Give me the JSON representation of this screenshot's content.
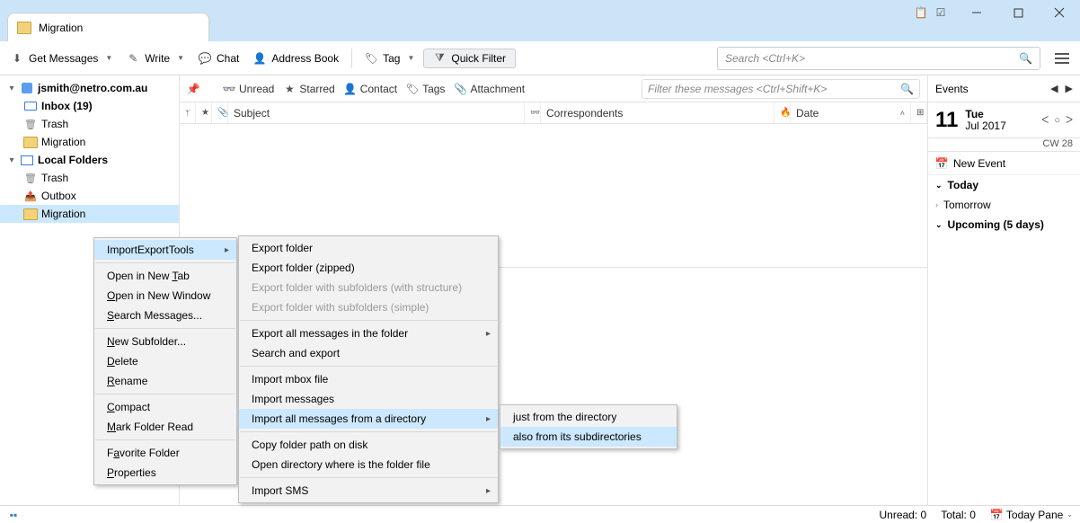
{
  "window": {
    "tab_title": "Migration"
  },
  "toolbar": {
    "get_messages": "Get Messages",
    "write": "Write",
    "chat": "Chat",
    "address_book": "Address Book",
    "tag": "Tag",
    "quick_filter": "Quick Filter",
    "search_placeholder": "Search <Ctrl+K>"
  },
  "tree": {
    "account": "jsmith@netro.com.au",
    "inbox": "Inbox (19)",
    "trash": "Trash",
    "migration": "Migration",
    "local_folders": "Local Folders",
    "lf_trash": "Trash",
    "lf_outbox": "Outbox",
    "lf_migration": "Migration"
  },
  "filterbar": {
    "unread": "Unread",
    "starred": "Starred",
    "contact": "Contact",
    "tags": "Tags",
    "attachment": "Attachment",
    "filter_placeholder": "Filter these messages <Ctrl+Shift+K>"
  },
  "columns": {
    "subject": "Subject",
    "correspondents": "Correspondents",
    "date": "Date"
  },
  "ctx1": {
    "import_export_tools": "ImportExportTools",
    "open_new_tab": "Open in New Tab",
    "open_new_window": "Open in New Window",
    "search_messages": "Search Messages...",
    "new_subfolder": "New Subfolder...",
    "delete": "Delete",
    "rename": "Rename",
    "compact": "Compact",
    "mark_folder_read": "Mark Folder Read",
    "favorite_folder": "Favorite Folder",
    "properties": "Properties"
  },
  "ctx2": {
    "export_folder": "Export folder",
    "export_folder_zipped": "Export folder (zipped)",
    "export_subfolders_structure": "Export folder with subfolders (with structure)",
    "export_subfolders_simple": "Export folder with subfolders (simple)",
    "export_all_messages": "Export all messages in the folder",
    "search_and_export": "Search and export",
    "import_mbox": "Import mbox file",
    "import_messages": "Import messages",
    "import_all_from_dir": "Import all messages from a directory",
    "copy_folder_path": "Copy folder path on disk",
    "open_directory": "Open directory where is the folder file",
    "import_sms": "Import SMS"
  },
  "ctx3": {
    "just_from_dir": "just from the directory",
    "also_from_sub": "also from its subdirectories"
  },
  "events": {
    "title": "Events",
    "day_num": "11",
    "day_name": "Tue",
    "month_year": "Jul 2017",
    "week": "CW 28",
    "new_event": "New Event",
    "today": "Today",
    "tomorrow": "Tomorrow",
    "upcoming": "Upcoming (5 days)"
  },
  "status": {
    "unread": "Unread: 0",
    "total": "Total: 0",
    "today_pane": "Today Pane"
  }
}
